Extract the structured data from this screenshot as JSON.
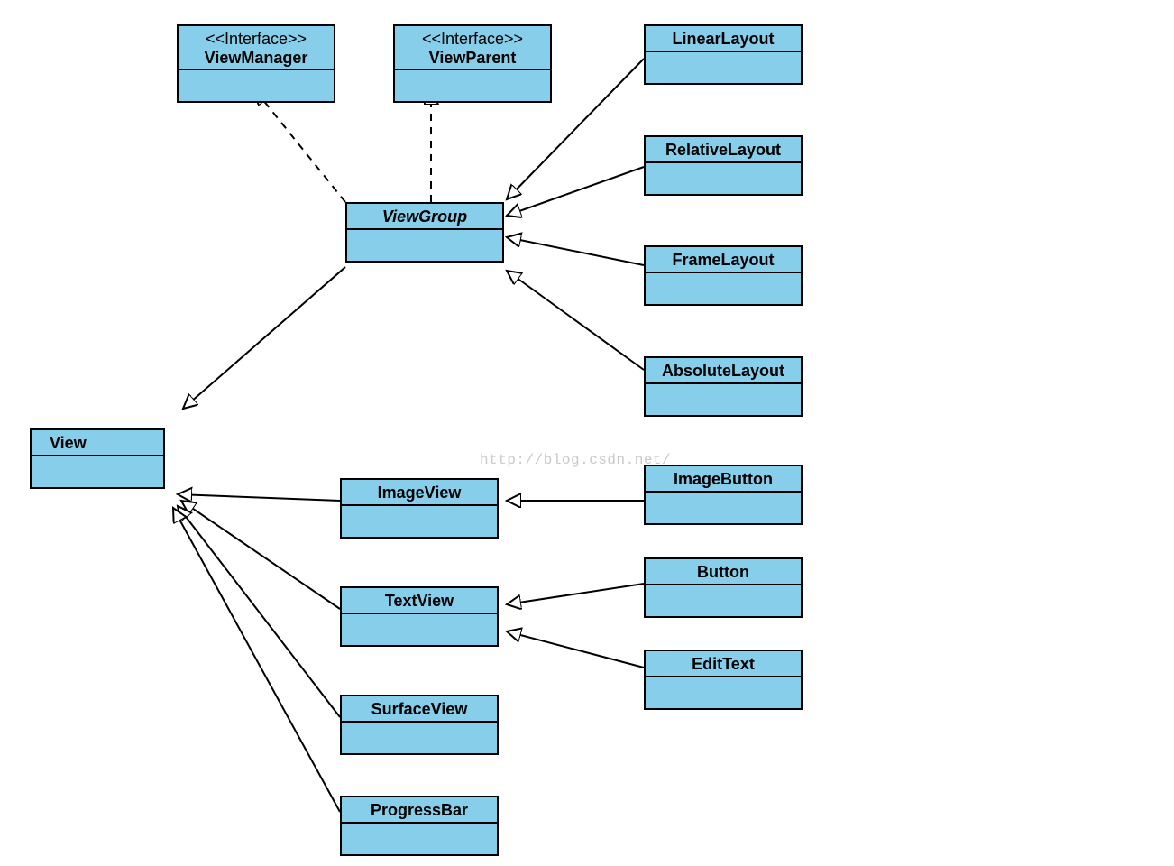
{
  "watermark": "http://blog.csdn.net/",
  "boxes": {
    "viewManager": {
      "stereotype": "<<Interface>>",
      "name": "ViewManager"
    },
    "viewParent": {
      "stereotype": "<<Interface>>",
      "name": "ViewParent"
    },
    "linearLayout": {
      "name": "LinearLayout"
    },
    "relativeLayout": {
      "name": "RelativeLayout"
    },
    "frameLayout": {
      "name": "FrameLayout"
    },
    "absoluteLayout": {
      "name": "AbsoluteLayout"
    },
    "viewGroup": {
      "name": "ViewGroup",
      "italic": true
    },
    "view": {
      "name": "View"
    },
    "imageView": {
      "name": "ImageView"
    },
    "textView": {
      "name": "TextView"
    },
    "surfaceView": {
      "name": "SurfaceView"
    },
    "progressBar": {
      "name": "ProgressBar"
    },
    "imageButton": {
      "name": "ImageButton"
    },
    "button": {
      "name": "Button"
    },
    "editText": {
      "name": "EditText"
    }
  },
  "relationships": [
    {
      "from": "ViewGroup",
      "to": "ViewManager",
      "kind": "realization"
    },
    {
      "from": "ViewGroup",
      "to": "ViewParent",
      "kind": "realization"
    },
    {
      "from": "ViewGroup",
      "to": "View",
      "kind": "generalization"
    },
    {
      "from": "LinearLayout",
      "to": "ViewGroup",
      "kind": "generalization"
    },
    {
      "from": "RelativeLayout",
      "to": "ViewGroup",
      "kind": "generalization"
    },
    {
      "from": "FrameLayout",
      "to": "ViewGroup",
      "kind": "generalization"
    },
    {
      "from": "AbsoluteLayout",
      "to": "ViewGroup",
      "kind": "generalization"
    },
    {
      "from": "ImageView",
      "to": "View",
      "kind": "generalization"
    },
    {
      "from": "TextView",
      "to": "View",
      "kind": "generalization"
    },
    {
      "from": "SurfaceView",
      "to": "View",
      "kind": "generalization"
    },
    {
      "from": "ProgressBar",
      "to": "View",
      "kind": "generalization"
    },
    {
      "from": "ImageButton",
      "to": "ImageView",
      "kind": "generalization"
    },
    {
      "from": "Button",
      "to": "TextView",
      "kind": "generalization"
    },
    {
      "from": "EditText",
      "to": "TextView",
      "kind": "generalization"
    }
  ]
}
